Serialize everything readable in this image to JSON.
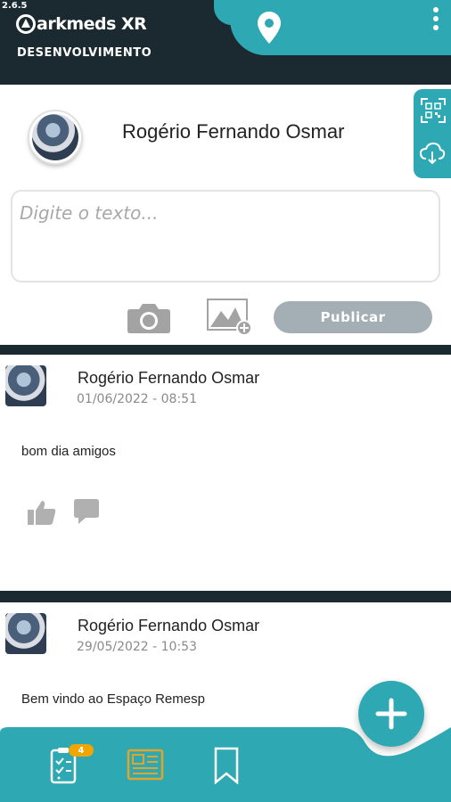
{
  "app": {
    "version": "2.6.5",
    "logo_text": "arkmeds XR",
    "environment": "DESENVOLVIMENTO"
  },
  "header": {
    "location_icon": "location-pin-icon",
    "menu_icon": "more-vertical-icon"
  },
  "compose": {
    "user_name": "Rogério Fernando Osmar",
    "placeholder": "Digite o texto...",
    "camera_icon": "camera-icon",
    "gallery_icon": "image-add-icon",
    "publish_label": "Publicar",
    "side_actions": [
      "qr-code-icon",
      "cloud-download-icon"
    ]
  },
  "posts": [
    {
      "author": "Rogério Fernando Osmar",
      "date": "01/06/2022 - 08:51",
      "text": "bom dia amigos"
    },
    {
      "author": "Rogério Fernando Osmar",
      "date": "29/05/2022 - 10:53",
      "text": "Bem vindo ao Espaço Remesp"
    }
  ],
  "bottom_nav": {
    "checklist_badge": "4",
    "items": [
      "checklist-icon",
      "news-icon",
      "bookmark-icon"
    ],
    "fab_icon": "plus-icon"
  },
  "colors": {
    "teal": "#2ea8b3",
    "dark": "#1b2a30",
    "badge": "#f0a500",
    "muted_button": "#a3aeb5",
    "news_accent": "#e0a52a"
  }
}
